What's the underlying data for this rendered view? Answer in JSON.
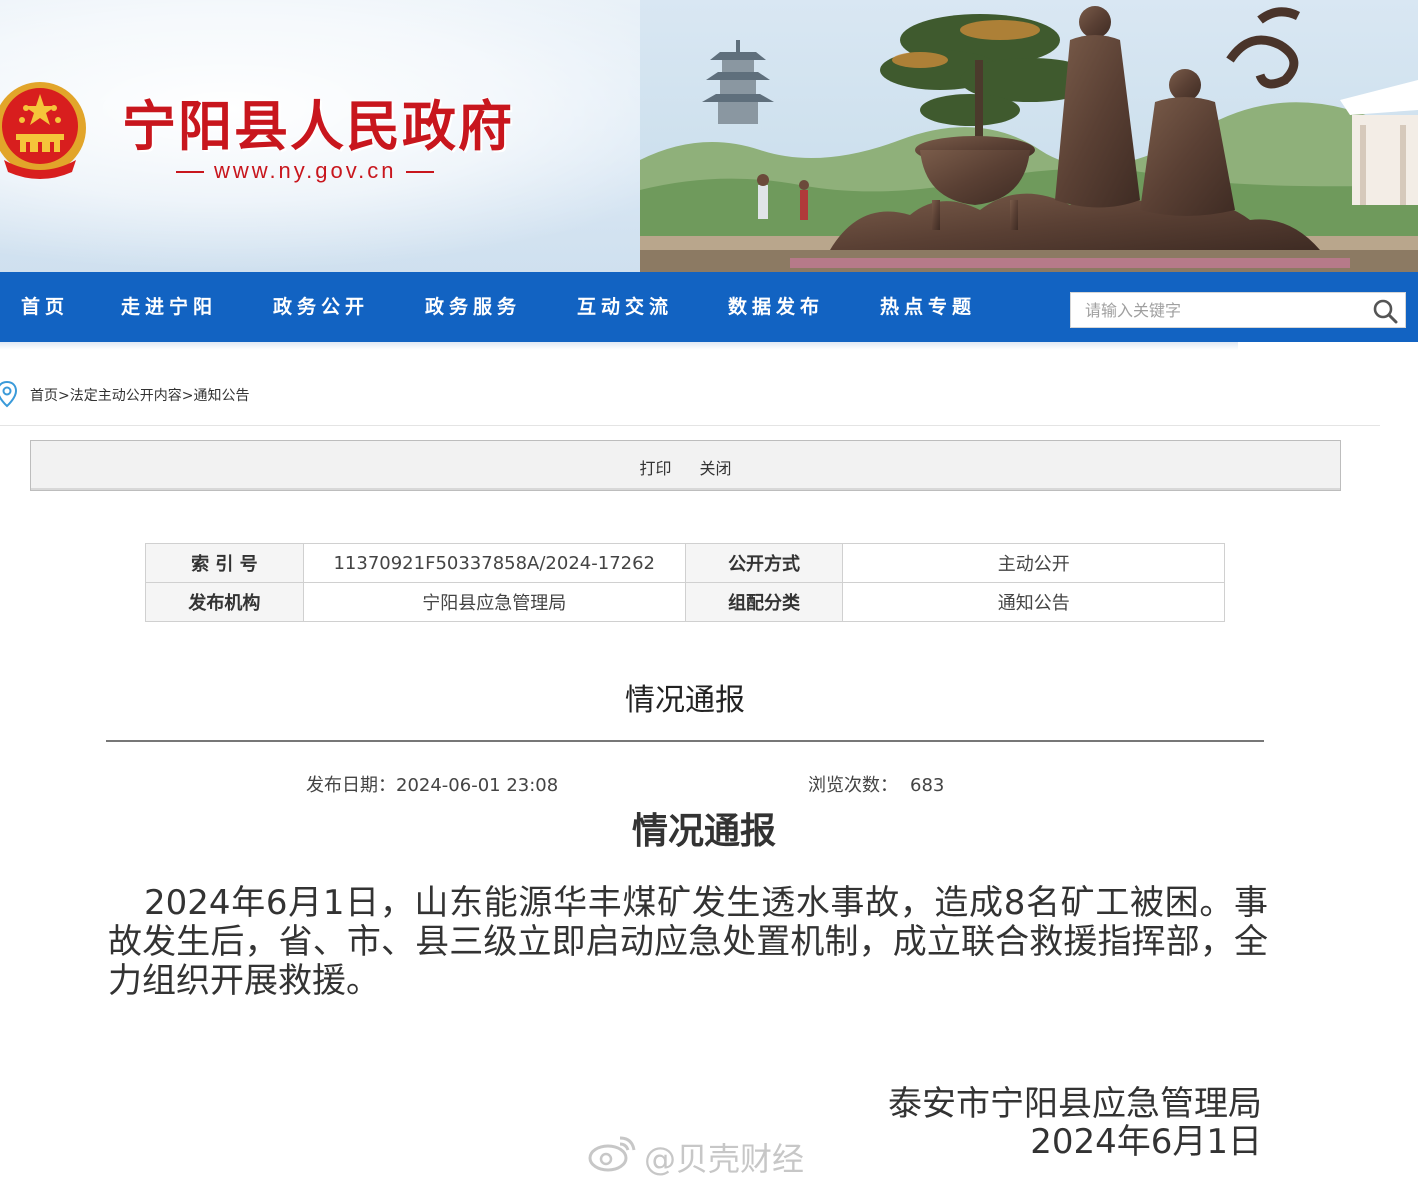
{
  "header": {
    "site_title": "宁阳县人民政府",
    "site_url": "www.ny.gov.cn"
  },
  "nav": {
    "items": [
      "首页",
      "走进宁阳",
      "政务公开",
      "政务服务",
      "互动交流",
      "数据发布",
      "热点专题"
    ],
    "search_placeholder": "请输入关键字"
  },
  "breadcrumb": {
    "home": "首页",
    "sep": ">",
    "section": "法定主动公开内容",
    "current": "通知公告"
  },
  "toolbar": {
    "print_label": "打印",
    "close_label": "关闭"
  },
  "meta": {
    "index_no_label": "索 引 号",
    "index_no": "11370921F50337858A/2024-17262",
    "disclosure_label": "公开方式",
    "disclosure": "主动公开",
    "publisher_label": "发布机构",
    "publisher": "宁阳县应急管理局",
    "category_label": "组配分类",
    "category": "通知公告"
  },
  "article": {
    "title": "情况通报",
    "pubdate_label": "发布日期：",
    "pubdate": "2024-06-01 23:08",
    "views_label": "浏览次数：",
    "views": "683",
    "body_title": "情况通报",
    "body": "2024年6月1日，山东能源华丰煤矿发生透水事故，造成8名矿工被困。事故发生后，省、市、县三级立即启动应急处置机制，成立联合救援指挥部，全力组织开展救援。",
    "sign_org": "泰安市宁阳县应急管理局",
    "sign_date": "2024年6月1日"
  },
  "watermark": {
    "text": "@贝壳财经"
  },
  "colors": {
    "nav_bg": "#1263c2",
    "title_red": "#c8161d"
  }
}
